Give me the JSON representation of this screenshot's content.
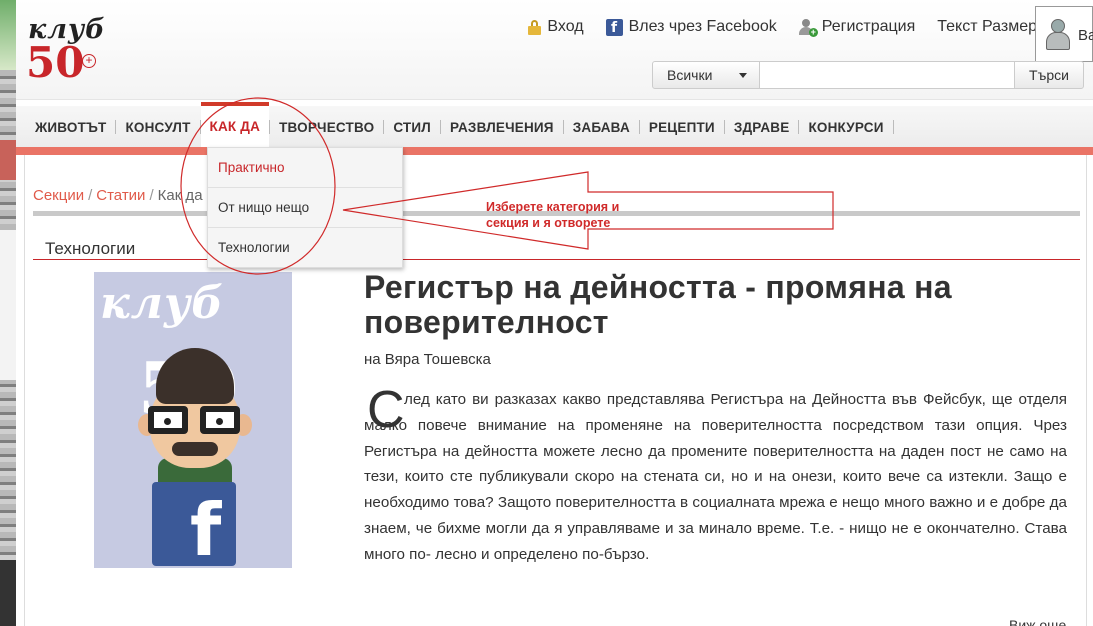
{
  "header": {
    "logo_top": "клуб",
    "logo_number": "50",
    "logo_plus": "+",
    "login_label": "Вход",
    "facebook_login_label": "Влез чрез Facebook",
    "register_label": "Регистрация",
    "text_size_label": "Текст Размер",
    "avatar_text": "Ва"
  },
  "search": {
    "category_value": "Всички",
    "input_value": "",
    "button_label": "Търси"
  },
  "nav": {
    "items": [
      {
        "label": "ЖИВОТЪТ"
      },
      {
        "label": "КОНСУЛТ"
      },
      {
        "label": "КАК ДА"
      },
      {
        "label": "ТВОРЧЕСТВО"
      },
      {
        "label": "СТИЛ"
      },
      {
        "label": "РАЗВЛЕЧЕНИЯ"
      },
      {
        "label": "ЗАБАВА"
      },
      {
        "label": "РЕЦЕПТИ"
      },
      {
        "label": "ЗДРАВЕ"
      },
      {
        "label": "КОНКУРСИ"
      }
    ],
    "active_index": 2
  },
  "dropdown": {
    "items": [
      "Практично",
      "От нищо нещо",
      "Технологии"
    ]
  },
  "breadcrumb": {
    "items": [
      "Секции",
      "Статии",
      "Как да"
    ]
  },
  "section_title": "Технологии",
  "article": {
    "image_text_top": "клуб",
    "image_text_number": "50",
    "title": "Регистър на дейността - промяна на поверителност",
    "byline": "на Вяра Тошевска",
    "dropcap": "С",
    "body": "лед като ви разказах какво представлява Регистъра на Дейността във Фейсбук, ще отделя малко повече внимание на променяне на поверителността посредством тази опция. Чрез Регистъра на дейността можете лесно да промените поверителността на даден пост не само на тези, които сте публикували скоро на стената си, но и на онези, които вече са изтекли. Защо е необходимо това? Защото поверителността в социалната мрежа е нещо много важно и е добре да знаем, че бихме могли да я управляваме и за минало време. Т.е. - нищо не е окончателно. Става много по- лесно и определено по-бързо.",
    "read_more": "Виж още..."
  },
  "annotation": {
    "line1": "Изберете категория и",
    "line2": "секция и я отворете",
    "color": "#d02a2a"
  },
  "colors": {
    "accent_red": "#c8262a",
    "nav_underline": "#ea7466",
    "link": "#e05a4a"
  }
}
